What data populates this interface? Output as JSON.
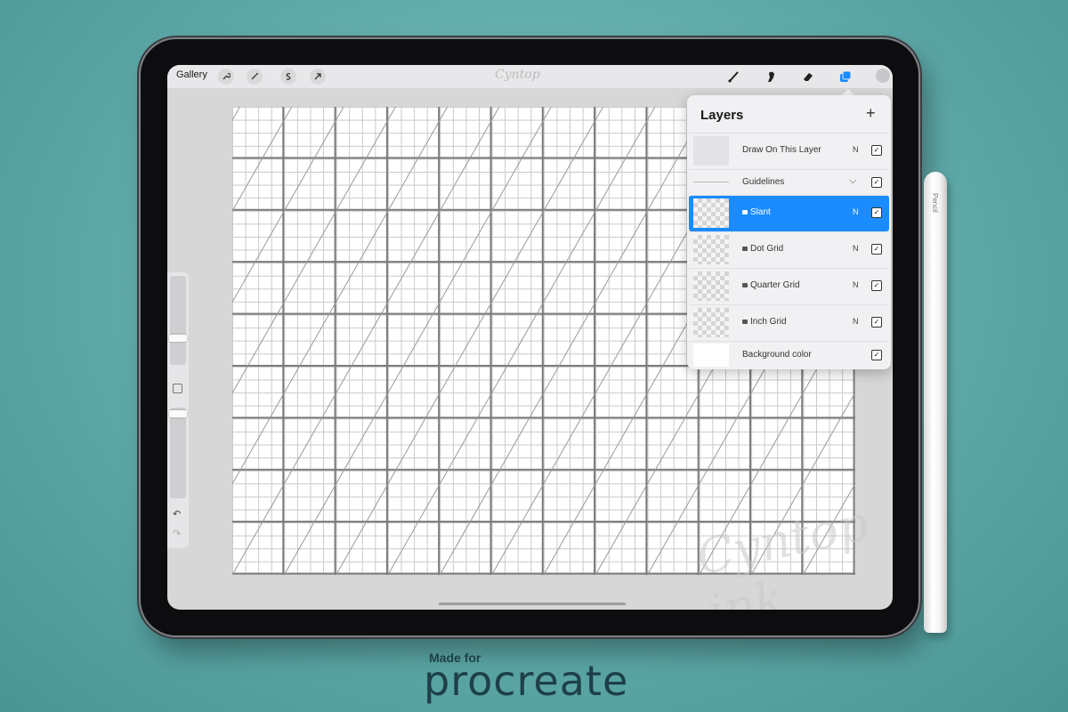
{
  "topbar": {
    "gallery_label": "Gallery",
    "watermark": "Cyntop"
  },
  "layers": {
    "title": "Layers",
    "add_symbol": "+",
    "rows": [
      {
        "name": "Draw On This Layer",
        "mode": "N",
        "locked": false,
        "selected": false
      },
      {
        "name": "Guidelines",
        "group": true
      },
      {
        "name": "Slant",
        "mode": "N",
        "locked": true,
        "selected": true
      },
      {
        "name": "Dot Grid",
        "mode": "N",
        "locked": true,
        "selected": false
      },
      {
        "name": "Quarter Grid",
        "mode": "N",
        "locked": true,
        "selected": false
      },
      {
        "name": "Inch Grid",
        "mode": "N",
        "locked": true,
        "selected": false
      },
      {
        "name": "Background color",
        "background": true
      }
    ]
  },
  "pencil": {
    "label": "Pencil"
  },
  "footer": {
    "made_for": "Made for",
    "brand": "procreate"
  },
  "watermark_corner": "Cyntop ink",
  "colors": {
    "accent": "#1a8cff",
    "background": "#5ea9a8",
    "brand_text": "#1e4048"
  }
}
